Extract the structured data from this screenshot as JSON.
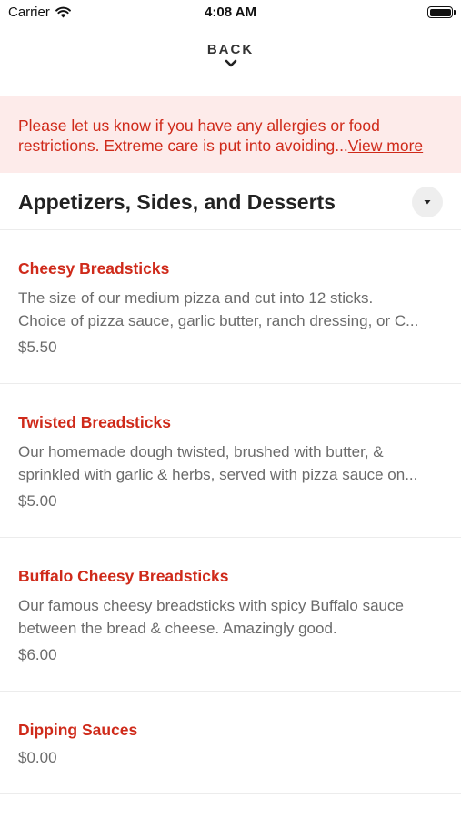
{
  "status_bar": {
    "carrier": "Carrier",
    "time": "4:08 AM"
  },
  "nav": {
    "back_label": "BACK"
  },
  "banner": {
    "text": "Please let us know if you have any allergies or food restrictions. Extreme care is put into avoiding...",
    "link": "View more"
  },
  "section": {
    "title": "Appetizers, Sides, and Desserts"
  },
  "items": [
    {
      "name": "Cheesy Breadsticks",
      "desc_line1": "The size of our medium pizza and cut into 12 sticks.",
      "desc_line2": "Choice of pizza sauce, garlic butter, ranch dressing, or C...",
      "price": "$5.50"
    },
    {
      "name": "Twisted Breadsticks",
      "desc_line1": "Our homemade dough twisted, brushed with butter, &",
      "desc_line2": "sprinkled with garlic & herbs, served with pizza sauce on...",
      "price": "$5.00"
    },
    {
      "name": "Buffalo Cheesy Breadsticks",
      "desc_line1": "Our famous cheesy breadsticks with spicy Buffalo sauce",
      "desc_line2": "between the bread & cheese. Amazingly good.",
      "price": "$6.00"
    },
    {
      "name": "Dipping Sauces",
      "price": "$0.00"
    }
  ],
  "colors": {
    "accent": "#cf2a1a",
    "banner_bg": "#fdebea",
    "muted_text": "#6b6b6b"
  },
  "icons": {
    "wifi": "wifi-icon",
    "battery": "battery-icon",
    "back": "chevron-down-icon",
    "collapse": "caret-down-icon"
  }
}
